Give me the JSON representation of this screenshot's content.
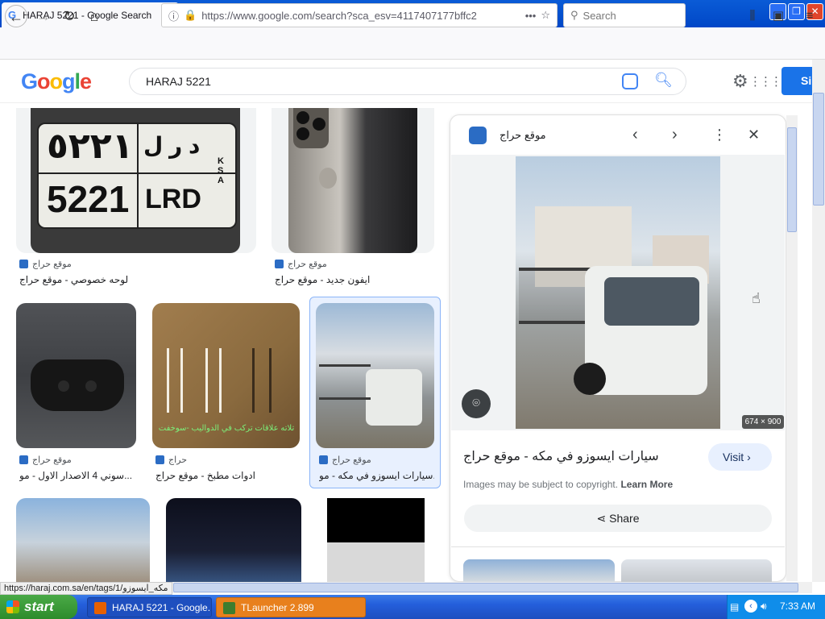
{
  "browser": {
    "tab_title": "HARAJ 5221 - Google Search",
    "tab_favicon": "G",
    "url": "https://www.google.com/search?sca_esv=4117407177bffc2",
    "search_placeholder": "Search"
  },
  "google": {
    "logo": "Google",
    "query": "HARAJ 5221",
    "signin_label": "Si"
  },
  "results": [
    {
      "source": "موقع حراج",
      "caption": "لوحه خصوصي - موقع حراج"
    },
    {
      "source": "موقع حراج",
      "caption": "ايفون جديد - موقع حراج"
    },
    {
      "source": "موقع حراج",
      "caption": "سوني 4 الاصدار الاول - مو..."
    },
    {
      "source": "حراج",
      "caption": "ادوات مطبخ - موقع حراج"
    },
    {
      "source": "موقع حراج",
      "caption": "سيارات ايسوزو في مكه - مو..."
    }
  ],
  "plate": {
    "arabic_number": "٥٢٢١",
    "arabic_letters": "د ر ل",
    "number": "5221",
    "letters": "LRD",
    "country": "KSA"
  },
  "kitchen_overlay": "تلاته علاقات تركب في الدواليب -سوخفت",
  "panel": {
    "site_name": "موقع حراج",
    "title": "سيارات ايسوزو في مكه - موقع حراج",
    "dimensions": "674 × 900",
    "visit_label": "Visit",
    "copyright_text": "Images may be subject to copyright.",
    "learn_more": "Learn More",
    "share_label": "Share"
  },
  "status_url": "https://haraj.com.sa/en/tags/1/مكه_ايسوزو",
  "taskbar": {
    "start_label": "start",
    "tasks": [
      {
        "label": "HARAJ 5221 - Google..."
      },
      {
        "label": "TLauncher 2.899"
      }
    ],
    "clock": "7:33 AM"
  },
  "colors": {
    "google_blue": "#4285f4",
    "signin_blue": "#1a73e8",
    "xp_taskbar": "#245edb",
    "xp_start_green": "#2d8c2b"
  }
}
